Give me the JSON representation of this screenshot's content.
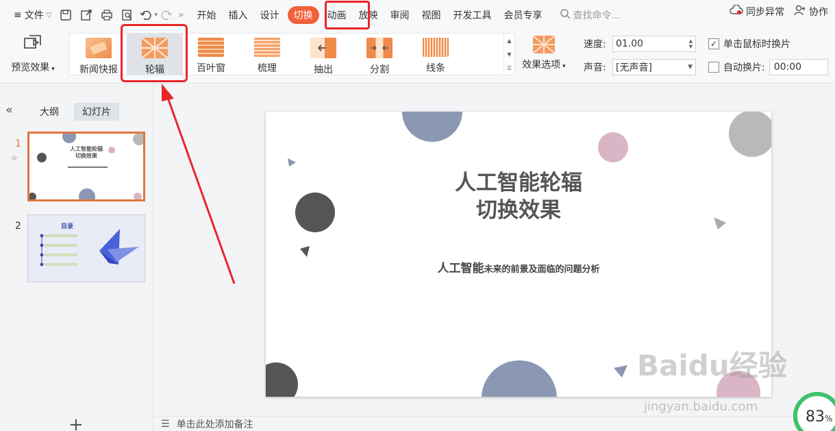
{
  "menubar": {
    "file_label": "文件",
    "tabs": [
      "开始",
      "插入",
      "设计",
      "切换",
      "动画",
      "放映",
      "审阅",
      "视图",
      "开发工具",
      "会员专享"
    ],
    "active_tab": "切换",
    "search_placeholder": "查找命令...",
    "sync_label": "同步异常",
    "collab_label": "协作"
  },
  "ribbon": {
    "preview_label": "预览效果",
    "transitions": [
      "新闻快报",
      "轮辐",
      "百叶窗",
      "梳理",
      "抽出",
      "分割",
      "线条"
    ],
    "selected_transition": "轮辐",
    "effect_options_label": "效果选项",
    "speed_label": "速度:",
    "speed_value": "01.00",
    "sound_label": "声音:",
    "sound_value": "[无声音]",
    "on_click_label": "单击鼠标时换片",
    "on_click_checked": true,
    "auto_label": "自动换片:",
    "auto_checked": false,
    "auto_time": "00:00"
  },
  "left_panel": {
    "tab_outline": "大纲",
    "tab_slides": "幻灯片",
    "slide_numbers": [
      "1",
      "2"
    ],
    "thumb1_title": "人工智能轮辐\n切换效果",
    "thumb2_title": "目录"
  },
  "slide": {
    "title_line1": "人工智能轮辐",
    "title_line2": "切换效果",
    "subtitle_big": "人工智能",
    "subtitle_rest": "未来的前景及面临的问题分析"
  },
  "notes_placeholder": "单击此处添加备注",
  "watermark": "Baidu经验",
  "watermark_url": "jingyan.baidu.com",
  "zoom": "83",
  "zoom_unit": "%",
  "colors": {
    "accent": "#f0603a",
    "highlight": "#e8262a",
    "circle_blue": "#8a98b3",
    "circle_dark": "#555555",
    "circle_pink": "#d9b5c5",
    "circle_gray": "#b9b9b9"
  }
}
